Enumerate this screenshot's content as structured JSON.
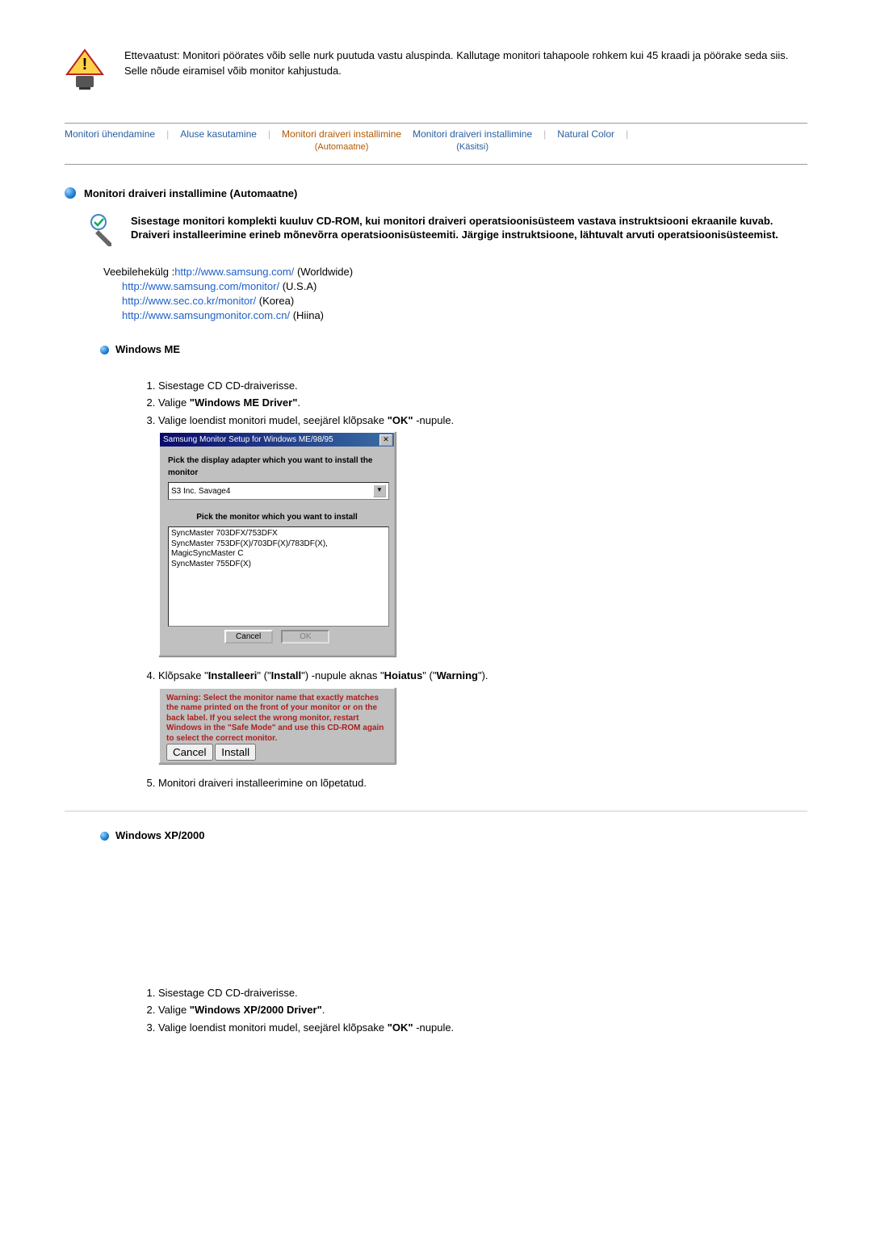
{
  "caution_text": "Ettevaatust: Monitori pöörates võib selle nurk puutuda vastu aluspinda. Kallutage monitori tahapoole rohkem kui 45 kraadi ja pöörake seda siis. Selle nõude eiramisel võib monitor kahjustuda.",
  "tabs": {
    "t1": "Monitori ühendamine",
    "t2": "Aluse kasutamine",
    "t3_main": "Monitori draiveri installimine",
    "t3_sub": "(Automaatne)",
    "t4_main": "Monitori draiveri installimine",
    "t4_sub": "(Käsitsi)",
    "t5": "Natural Color"
  },
  "section_title": "Monitori draiveri installimine (Automaatne)",
  "mouse_text": "Sisestage monitori komplekti kuuluv CD-ROM, kui monitori draiveri operatsioonisüsteem vastava instruktsiooni ekraanile kuvab. Draiveri installeerimine erineb mõnevõrra operatsioonisüsteemiti. Järgige instruktsioone, lähtuvalt arvuti operatsioonisüsteemist.",
  "web": {
    "label": "Veebilehekülg :",
    "u1": "http://www.samsung.com/",
    "d1": "(Worldwide)",
    "u2": "http://www.samsung.com/monitor/",
    "d2": "(U.S.A)",
    "u3": "http://www.sec.co.kr/monitor/",
    "d3": "(Korea)",
    "u4": "http://www.samsungmonitor.com.cn/",
    "d4": "(Hiina)"
  },
  "me": {
    "title": "Windows ME",
    "s1": "Sisestage CD CD-draiverisse.",
    "s2a": "Valige ",
    "s2b": "\"Windows ME Driver\"",
    "s3a": "Valige loendist monitori mudel, seejärel klõpsake ",
    "s3b": "\"OK\"",
    "s3c": " -nupule.",
    "dlg1": {
      "title": "Samsung Monitor Setup for Windows ME/98/95",
      "lbl1": "Pick the display adapter which you want to install the monitor",
      "combo": "S3 Inc. Savage4",
      "lbl2": "Pick the monitor which you want to install",
      "li1": "SyncMaster 703DFX/753DFX",
      "li2": "SyncMaster 753DF(X)/703DF(X)/783DF(X), MagicSyncMaster C",
      "li3": "SyncMaster 755DF(X)",
      "cancel": "Cancel",
      "ok": "OK"
    },
    "s4a": "Klõpsake \"",
    "s4b": "Installeeri",
    "s4c": "\" (\"",
    "s4d": "Install",
    "s4e": "\") -nupule aknas \"",
    "s4f": "Hoiatus",
    "s4g": "\" (\"",
    "s4h": "Warning",
    "s4i": "\").",
    "dlg2": {
      "warn": "Warning: Select the monitor name that exactly matches the name printed on the front of your monitor or on the back label. If you select the wrong monitor, restart Windows in the \"Safe Mode\" and use this CD-ROM again to select the correct monitor.",
      "cancel": "Cancel",
      "install": "Install"
    },
    "s5": "Monitori draiveri installeerimine on lõpetatud."
  },
  "xp": {
    "title": "Windows XP/2000",
    "s1": "Sisestage CD CD-draiverisse.",
    "s2a": "Valige ",
    "s2b": "\"Windows XP/2000 Driver\"",
    "s3a": "Valige loendist monitori mudel, seejärel klõpsake ",
    "s3b": "\"OK\"",
    "s3c": " -nupule."
  }
}
